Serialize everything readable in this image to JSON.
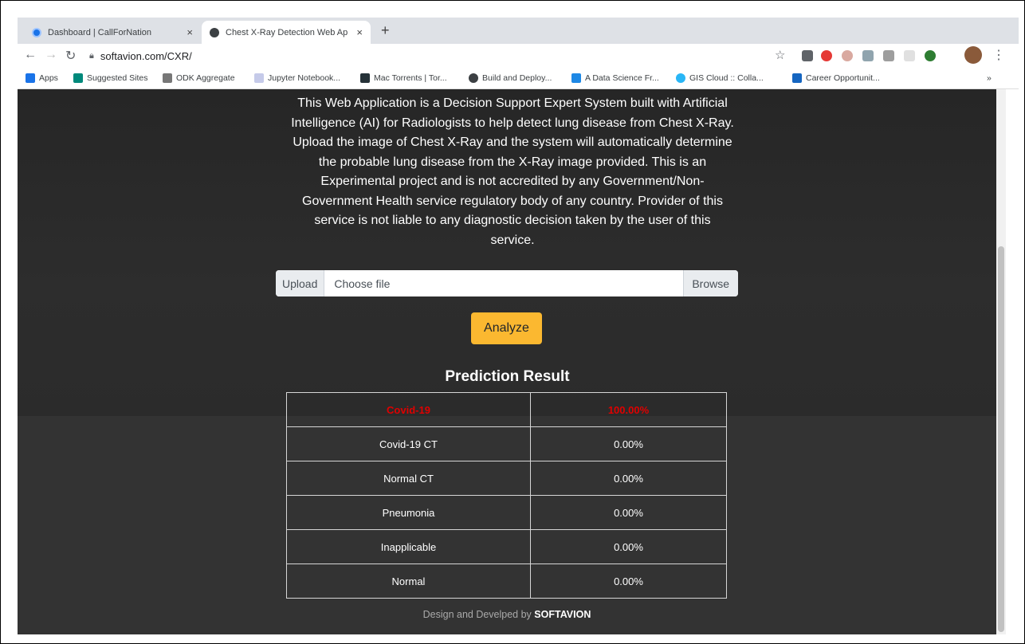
{
  "browser": {
    "tabs": [
      {
        "title": "Dashboard | CallForNation",
        "close": "×"
      },
      {
        "title": "Chest X-Ray Detection Web Ap",
        "close": "×"
      }
    ],
    "new_tab": "+",
    "url": "softavion.com/CXR/",
    "bookmarks": [
      "Apps",
      "Suggested Sites",
      "ODK Aggregate",
      "Jupyter Notebook...",
      "Mac Torrents | Tor...",
      "Build and Deploy...",
      "A Data Science Fr...",
      "GIS Cloud :: Colla...",
      "Career Opportunit..."
    ],
    "more": "»"
  },
  "page": {
    "description": "This Web Application is a Decision Support Expert System built with Artificial Intelligence (AI) for Radiologists to help detect lung disease from Chest X-Ray. Upload the image of Chest X-Ray and the system will automatically determine the probable lung disease from the X-Ray image provided. This is an Experimental project and is not accredited by any Government/Non-Government Health service regulatory body of any country. Provider of this service is not liable to any diagnostic decision taken by the user of this service.",
    "upload": {
      "label": "Upload",
      "file_placeholder": "Choose file",
      "browse": "Browse"
    },
    "analyze_label": "Analyze",
    "result_title": "Prediction Result",
    "results": [
      {
        "label": "Covid-19",
        "value": "100.00%"
      },
      {
        "label": "Covid-19 CT",
        "value": "0.00%"
      },
      {
        "label": "Normal CT",
        "value": "0.00%"
      },
      {
        "label": "Pneumonia",
        "value": "0.00%"
      },
      {
        "label": "Inapplicable",
        "value": "0.00%"
      },
      {
        "label": "Normal",
        "value": "0.00%"
      }
    ],
    "footer_prefix": "Design and Develped by ",
    "footer_brand": "SOFTAVION"
  }
}
